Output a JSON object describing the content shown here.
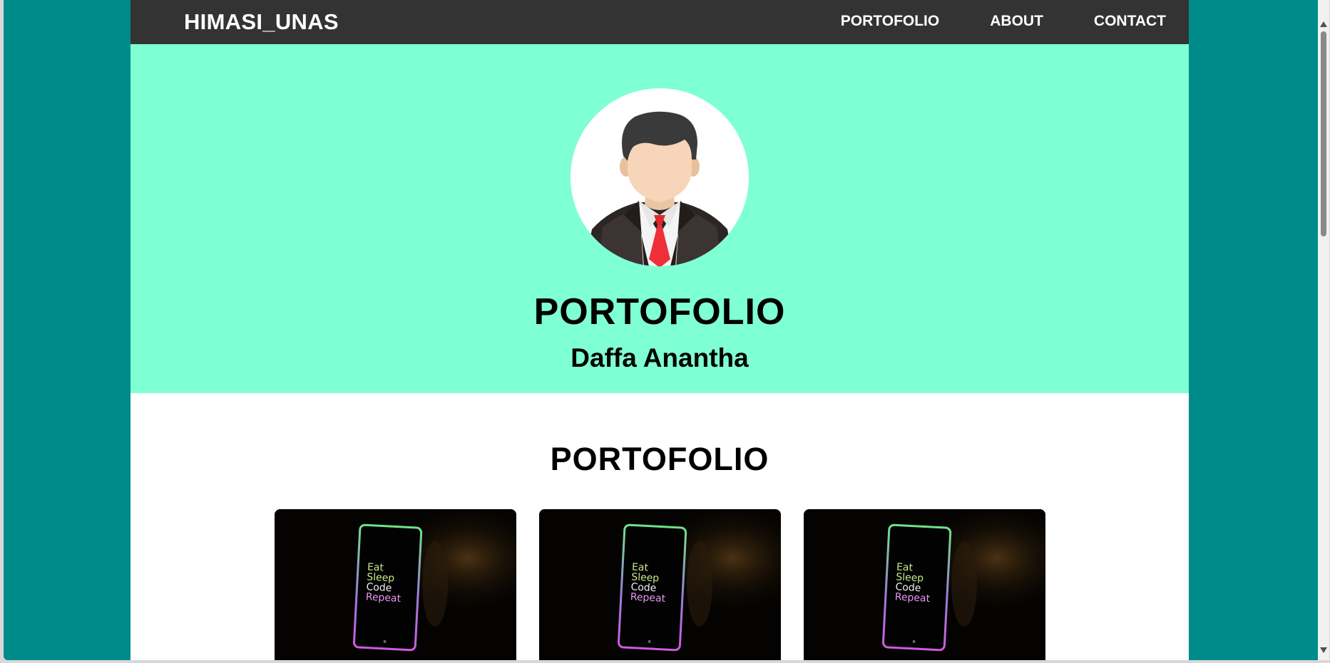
{
  "navbar": {
    "brand": "HIMASI_UNAS",
    "links": [
      {
        "label": "PORTOFOLIO"
      },
      {
        "label": "ABOUT"
      },
      {
        "label": "CONTACT"
      }
    ],
    "background": "#333333"
  },
  "hero": {
    "title": "PORTOFOLIO",
    "subtitle": "Daffa Anantha",
    "avatar_icon": "businessman-avatar",
    "background": "#7fffd4"
  },
  "portfolio": {
    "title": "PORTOFOLIO",
    "cards": [
      {
        "image_text": [
          "Eat",
          "Sleep",
          "Code",
          "Repeat"
        ]
      },
      {
        "image_text": [
          "Eat",
          "Sleep",
          "Code",
          "Repeat"
        ]
      },
      {
        "image_text": [
          "Eat",
          "Sleep",
          "Code",
          "Repeat"
        ]
      }
    ]
  },
  "colors": {
    "page_background": "#008b8b",
    "container_background": "#ffffff"
  }
}
